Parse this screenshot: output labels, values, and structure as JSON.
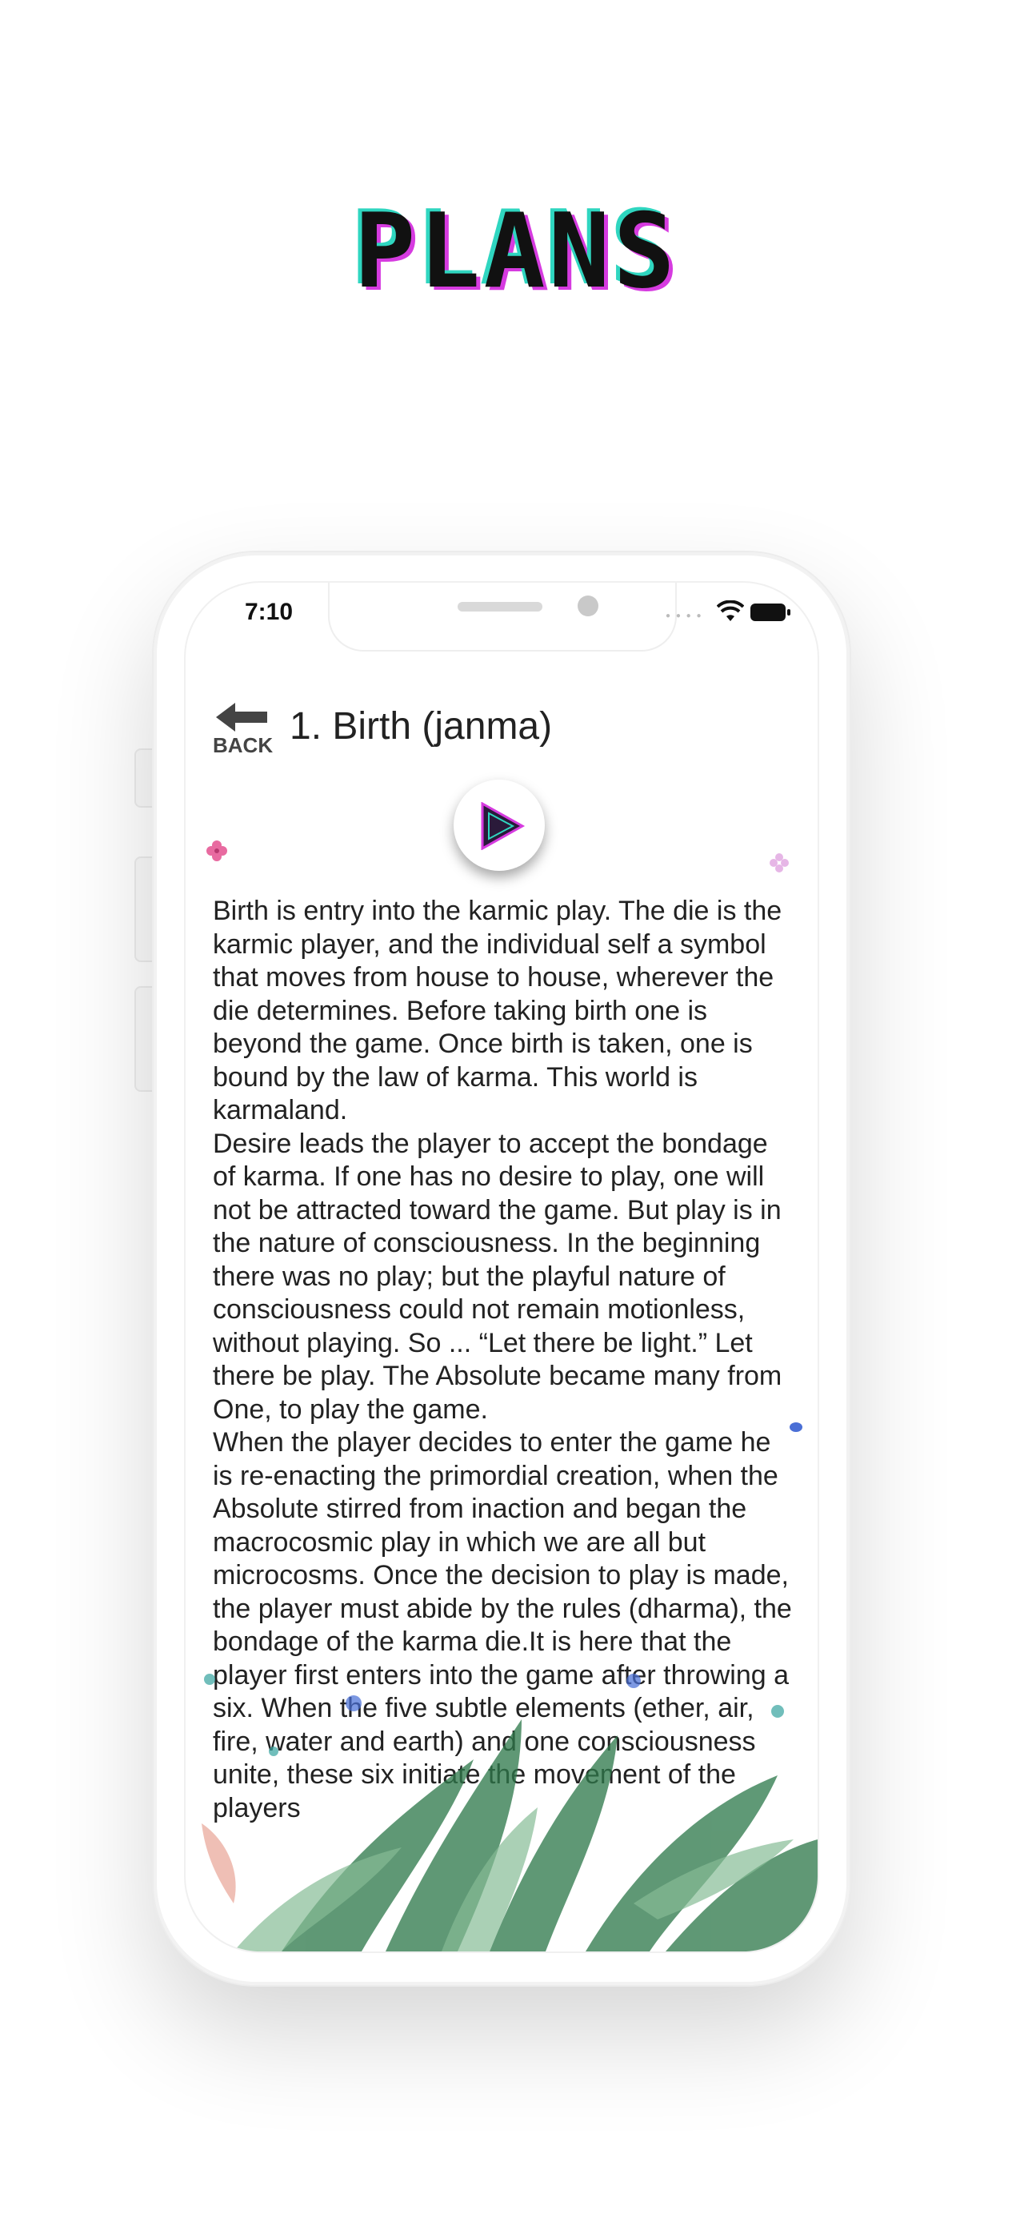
{
  "header": {
    "title": "PLANS"
  },
  "status_bar": {
    "time": "7:10"
  },
  "nav": {
    "back_label": "BACK"
  },
  "page": {
    "title": "1. Birth (janma)"
  },
  "content": {
    "paragraphs": [
      "Birth is entry into the karmic play. The die is the karmic player, and the individual self a symbol that moves from house to house, wherever the die determines. Before taking birth one is beyond the game. Once birth is taken, one is bound by the law of karma. This world is karmaland.",
      "Desire leads the player to accept the bondage of karma. If one has no desire to play, one will not be attracted toward the game. But play is in the nature of consciousness. In the beginning there was no play; but the playful nature of consciousness could not remain motionless, without playing. So ... “Let there be light.” Let there be play. The Absolute became many from One, to play the game.",
      "When the player decides to enter the game he is re-enacting the primordial creation, when the Absolute stirred from inaction and began the macrocosmic play in which we are all but microcosms. Once the decision to play is made, the player must abide by the rules (dharma), the bondage of the karma die.It is here that the player first enters into the game after throwing a six. When the five subtle elements (ether, air, fire, water and earth) and one consciousness unite, these six initiate the movement of the players"
    ]
  },
  "colors": {
    "title_cyan": "#2fd6c0",
    "title_magenta": "#d63be0",
    "play_triangle": "#2a1a3a",
    "play_accent": "#d63be0"
  },
  "icons": [
    "back-arrow-icon",
    "play-icon",
    "wifi-icon",
    "battery-icon",
    "plant-illustration"
  ]
}
